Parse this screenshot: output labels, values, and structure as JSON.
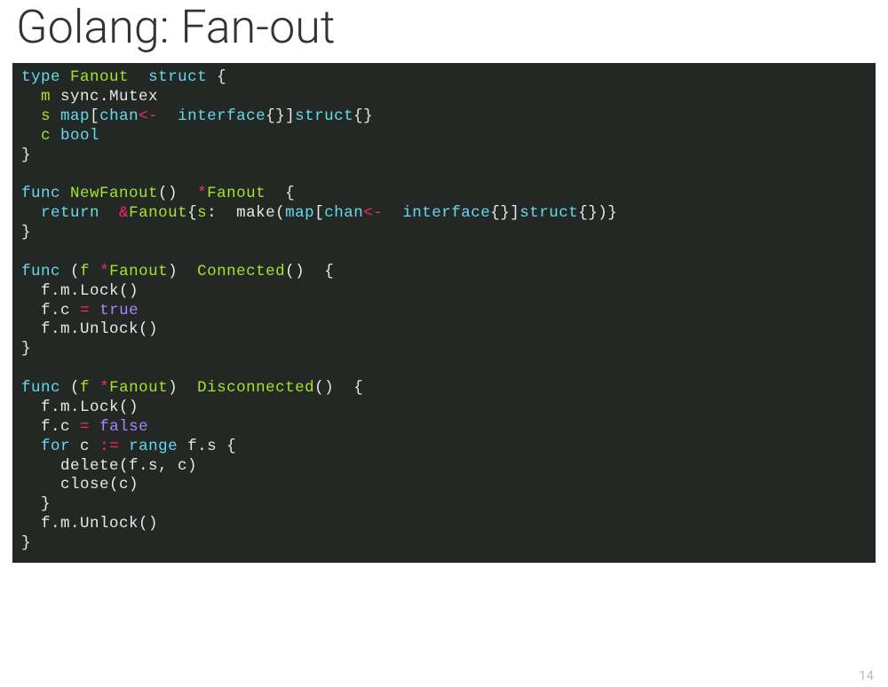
{
  "title": "Golang: Fan-out",
  "page_number": "14",
  "code": {
    "l1": {
      "kw1": "type",
      "name": "Fanout",
      "kw2": "struct",
      "brace": "{"
    },
    "l2": {
      "field": "m",
      "type": "sync.Mutex"
    },
    "l3": {
      "field": "s",
      "kw_map": "map",
      "b1": "[",
      "kw_chan": "chan",
      "op_arrow": "<-",
      "kw_iface": "interface",
      "br1": "{}]",
      "kw_struct": "struct",
      "br2": "{}"
    },
    "l4": {
      "field": "c",
      "type": "bool"
    },
    "l5": {
      "brace": "}"
    },
    "l6": "",
    "l7": {
      "kw_func": "func",
      "name": "NewFanout",
      "parens": "()",
      "op_star": "*",
      "ret": "Fanout",
      "brace": "{"
    },
    "l8": {
      "kw_ret": "return",
      "op_amp": "&",
      "name": "Fanout",
      "b1": "{",
      "field": "s",
      "colon": ":",
      "make": "make",
      "p1": "(",
      "kw_map": "map",
      "b2": "[",
      "kw_chan": "chan",
      "op_arrow": "<-",
      "kw_iface": "interface",
      "br1": "{}]",
      "kw_struct": "struct",
      "br2": "{})}"
    },
    "l9": {
      "brace": "}"
    },
    "l10": "",
    "l11": {
      "kw_func": "func",
      "p1": "(",
      "recv": "f",
      "op_star": "*",
      "rtype": "Fanout",
      "p2": ")",
      "name": "Connected",
      "parens": "()",
      "brace": "{"
    },
    "l12": {
      "text": "f.m.Lock()"
    },
    "l13": {
      "lhs": "f.c",
      "op": "=",
      "val": "true"
    },
    "l14": {
      "text": "f.m.Unlock()"
    },
    "l15": {
      "brace": "}"
    },
    "l16": "",
    "l17": {
      "kw_func": "func",
      "p1": "(",
      "recv": "f",
      "op_star": "*",
      "rtype": "Fanout",
      "p2": ")",
      "name": "Disconnected",
      "parens": "()",
      "brace": "{"
    },
    "l18": {
      "text": "f.m.Lock()"
    },
    "l19": {
      "lhs": "f.c",
      "op": "=",
      "val": "false"
    },
    "l20": {
      "kw_for": "for",
      "var": "c",
      "op": ":=",
      "kw_range": "range",
      "expr": "f.s",
      "brace": "{"
    },
    "l21": {
      "text": "delete(f.s, c)"
    },
    "l22": {
      "text": "close(c)"
    },
    "l23": {
      "brace": "}"
    },
    "l24": {
      "text": "f.m.Unlock()"
    },
    "l25": {
      "brace": "}"
    }
  }
}
